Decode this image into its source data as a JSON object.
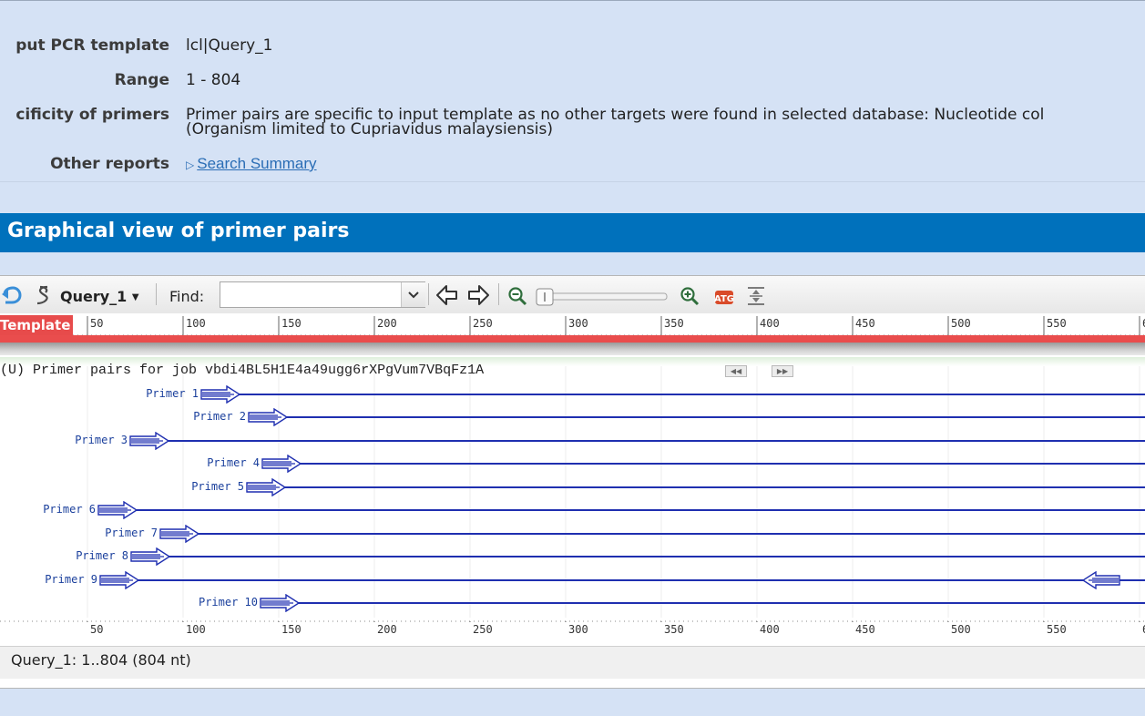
{
  "summary": {
    "rows": [
      {
        "label": "put PCR template",
        "value": "lcl|Query_1"
      },
      {
        "label": "Range",
        "value": "1 - 804"
      },
      {
        "label": "cificity of primers",
        "value_line1": "Primer pairs are specific to input template as no other targets were found in selected database: Nucleotide col",
        "value_line2": "(Organism limited to Cupriavidus malaysiensis)"
      },
      {
        "label": "Other reports",
        "link": "Search Summary"
      }
    ]
  },
  "section": {
    "title": "Graphical view of primer pairs"
  },
  "toolbar": {
    "sequence_label": "Query_1",
    "find_label": "Find:",
    "find_value": ""
  },
  "ruler": {
    "badge": "Template",
    "ticks": [
      "50",
      "100",
      "150",
      "200",
      "250",
      "300",
      "350",
      "400",
      "450",
      "500",
      "550",
      "6"
    ]
  },
  "track": {
    "title": "(U) Primer pairs for job vbdi4BL5H1E4a49ugg6rXPgVum7VBqFz1A",
    "primers": [
      {
        "label": "Primer 1"
      },
      {
        "label": "Primer 2"
      },
      {
        "label": "Primer 3"
      },
      {
        "label": "Primer 4"
      },
      {
        "label": "Primer 5"
      },
      {
        "label": "Primer 6"
      },
      {
        "label": "Primer 7"
      },
      {
        "label": "Primer 8"
      },
      {
        "label": "Primer 9"
      },
      {
        "label": "Primer 10"
      }
    ]
  },
  "status": {
    "text": "Query_1: 1..804 (804 nt)"
  },
  "colors": {
    "section_header": "#0071bc",
    "template_bar": "#e94d4d",
    "primer": "#1f2fb0"
  }
}
